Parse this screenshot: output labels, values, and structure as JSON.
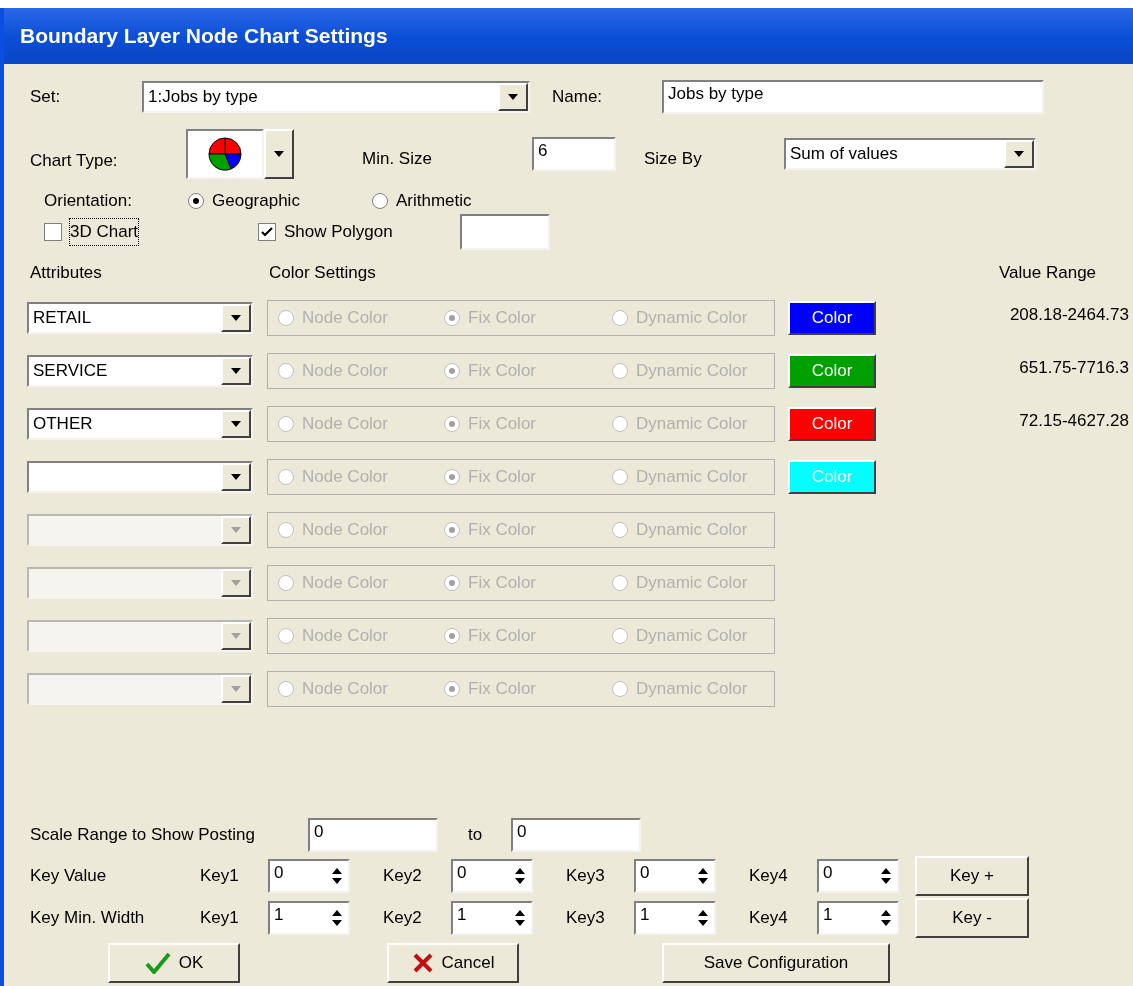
{
  "window": {
    "title": "Boundary Layer Node Chart Settings"
  },
  "set": {
    "label": "Set:",
    "value": "1:Jobs by type"
  },
  "name": {
    "label": "Name:",
    "value": "Jobs by type"
  },
  "chart_type": {
    "label": "Chart Type:"
  },
  "min_size": {
    "label": "Min. Size",
    "value": "6"
  },
  "size_by": {
    "label": "Size By",
    "value": "Sum of values"
  },
  "orientation": {
    "label": "Orientation:",
    "options": [
      {
        "label": "Geographic",
        "selected": true
      },
      {
        "label": "Arithmetic",
        "selected": false
      }
    ]
  },
  "chart_3d": {
    "label": "3D Chart",
    "checked": false
  },
  "show_polygon": {
    "label": "Show Polygon",
    "checked": true
  },
  "headers": {
    "attributes": "Attributes",
    "color_settings": "Color Settings",
    "value_range": "Value Range"
  },
  "rows": [
    {
      "attribute": "RETAIL",
      "disabled": false,
      "options": [
        {
          "label": "Node Color",
          "selected": false
        },
        {
          "label": "Fix Color",
          "selected": true
        },
        {
          "label": "Dynamic Color",
          "selected": false
        }
      ],
      "color_button": {
        "label": "Color",
        "color": "#0000ff"
      },
      "value_range": "208.18-2464.73"
    },
    {
      "attribute": "SERVICE",
      "disabled": false,
      "options": [
        {
          "label": "Node Color",
          "selected": false
        },
        {
          "label": "Fix Color",
          "selected": true
        },
        {
          "label": "Dynamic Color",
          "selected": false
        }
      ],
      "color_button": {
        "label": "Color",
        "color": "#00a000"
      },
      "value_range": "651.75-7716.3"
    },
    {
      "attribute": "OTHER",
      "disabled": false,
      "options": [
        {
          "label": "Node Color",
          "selected": false
        },
        {
          "label": "Fix Color",
          "selected": true
        },
        {
          "label": "Dynamic Color",
          "selected": false
        }
      ],
      "color_button": {
        "label": "Color",
        "color": "#ff0000"
      },
      "value_range": "72.15-4627.28"
    },
    {
      "disabled": false,
      "options": [
        {
          "label": "Node Color",
          "selected": false
        },
        {
          "label": "Fix Color",
          "selected": true
        },
        {
          "label": "Dynamic Color",
          "selected": false
        }
      ],
      "color_button": {
        "label": "Color",
        "color": "#00ffff"
      }
    },
    {
      "disabled": true,
      "options": [
        {
          "label": "Node Color",
          "selected": false
        },
        {
          "label": "Fix Color",
          "selected": true
        },
        {
          "label": "Dynamic Color",
          "selected": false
        }
      ]
    },
    {
      "disabled": true,
      "options": [
        {
          "label": "Node Color",
          "selected": false
        },
        {
          "label": "Fix Color",
          "selected": true
        },
        {
          "label": "Dynamic Color",
          "selected": false
        }
      ]
    },
    {
      "disabled": true,
      "options": [
        {
          "label": "Node Color",
          "selected": false
        },
        {
          "label": "Fix Color",
          "selected": true
        },
        {
          "label": "Dynamic Color",
          "selected": false
        }
      ]
    },
    {
      "disabled": true,
      "options": [
        {
          "label": "Node Color",
          "selected": false
        },
        {
          "label": "Fix Color",
          "selected": true
        },
        {
          "label": "Dynamic Color",
          "selected": false
        }
      ]
    }
  ],
  "scale_range": {
    "label": "Scale Range to Show Posting",
    "from": "0",
    "to_label": "to",
    "to": "0"
  },
  "key_rows": [
    {
      "label": "Key Value",
      "keys": [
        {
          "label": "Key1",
          "value": "0"
        },
        {
          "label": "Key2",
          "value": "0"
        },
        {
          "label": "Key3",
          "value": "0"
        },
        {
          "label": "Key4",
          "value": "0"
        }
      ],
      "button": "Key +"
    },
    {
      "label": "Key Min. Width",
      "keys": [
        {
          "label": "Key1",
          "value": "1"
        },
        {
          "label": "Key2",
          "value": "1"
        },
        {
          "label": "Key3",
          "value": "1"
        },
        {
          "label": "Key4",
          "value": "1"
        }
      ],
      "button": "Key -"
    }
  ],
  "buttons": {
    "ok": "OK",
    "cancel": "Cancel",
    "save": "Save Configuration"
  }
}
